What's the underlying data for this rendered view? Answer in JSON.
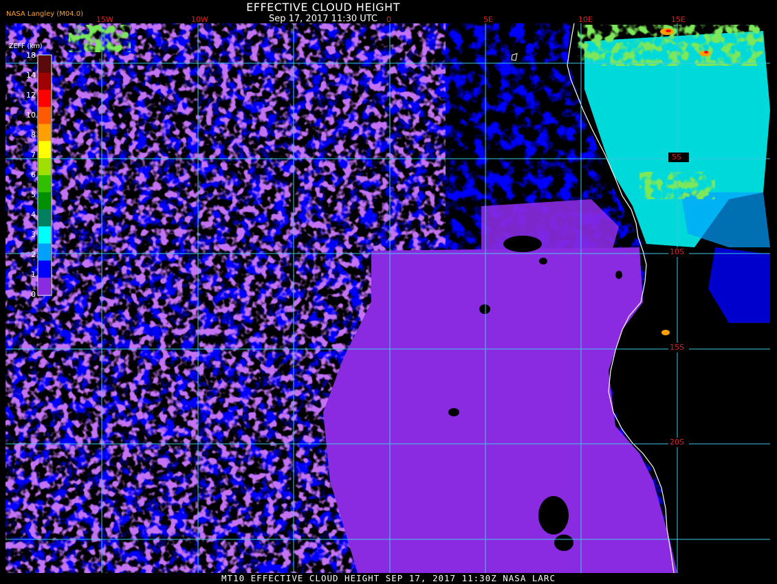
{
  "header": {
    "title": "EFFECTIVE CLOUD HEIGHT",
    "subtitle": "Sep 17, 2017 11:30 UTC",
    "provider": "NASA Langley (M04.0)"
  },
  "footer": {
    "caption": "MT10  EFFECTIVE CLOUD HEIGHT   SEP 17, 2017 11:30Z   NASA LARC"
  },
  "legend": {
    "title": "ZEFF (km)",
    "ticks": [
      "18",
      "14",
      "12",
      "10",
      "8",
      "7",
      "6",
      "5",
      "4",
      "3",
      "2",
      "1",
      "0"
    ],
    "colors": [
      "#5a0a0a",
      "#a00000",
      "#ff0000",
      "#ff5a00",
      "#ffa000",
      "#ffff00",
      "#a0e000",
      "#30c000",
      "#009000",
      "#008060",
      "#00ffff",
      "#00a0ff",
      "#0000ff",
      "#8a2be2"
    ]
  },
  "map": {
    "lon_labels": [
      "15W",
      "10W",
      "0",
      "5E",
      "10E",
      "15E"
    ],
    "lat_labels": [
      "5S",
      "10S",
      "15S",
      "20S"
    ],
    "colors": {
      "graticule": "#40c8e8",
      "coastline": "#ffffff",
      "grid_label": "#e02020",
      "low_cloud": "#0000ff",
      "very_low_cloud": "#8a2be2",
      "mid_cloud": "#00ffff",
      "clear": "#000000"
    }
  }
}
